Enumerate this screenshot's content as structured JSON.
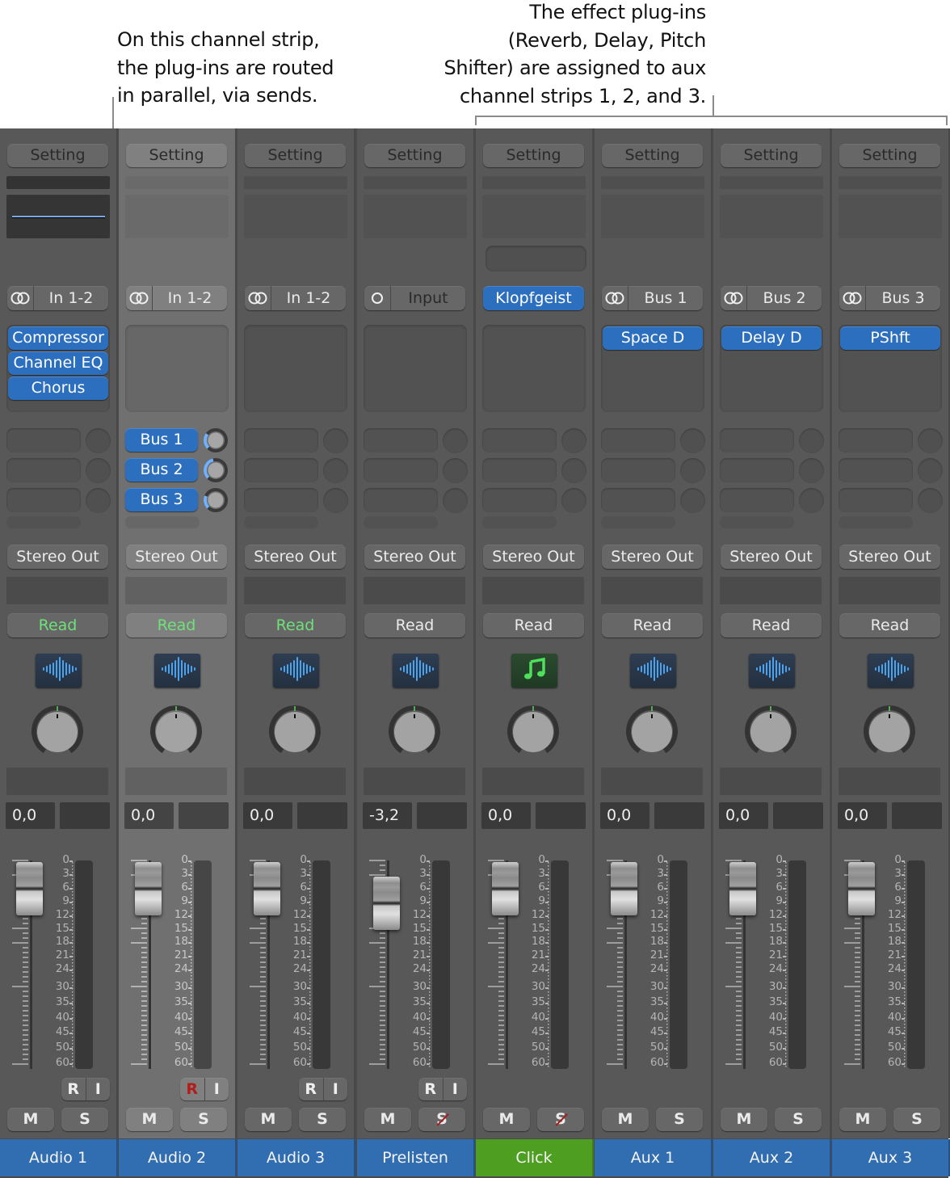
{
  "annotations": {
    "left": "On this channel strip,\nthe plug-ins are routed\nin parallel, via sends.",
    "right": "The effect plug-ins\n(Reverb, Delay, Pitch\nShifter) are assigned to aux\nchannel strips 1, 2, and 3."
  },
  "mixer": {
    "setting_label": "Setting",
    "fader_scale": [
      "0",
      "3",
      "6",
      "9",
      "12",
      "15",
      "18",
      "21",
      "24",
      "30",
      "35",
      "40",
      "45",
      "50",
      "60"
    ],
    "mute_label": "M",
    "solo_label": "S",
    "record_label": "R",
    "input_monitor_label": "I",
    "strips": [
      {
        "name": "Audio 1",
        "input": "In 1-2",
        "input_icon": "stereo-link-icon",
        "inserts": [
          "Compressor",
          "Channel EQ",
          "Chorus"
        ],
        "sends": [],
        "output": "Stereo Out",
        "automation": "Read",
        "automation_active": true,
        "track_icon": "waveform-icon",
        "volume": "0,0",
        "fader_db": 0.0,
        "record_enabled": false,
        "solo_available": true,
        "has_ri": true,
        "name_color": "#316db1",
        "selected": false
      },
      {
        "name": "Audio 2",
        "input": "In 1-2",
        "input_icon": "stereo-link-icon",
        "inserts": [],
        "sends": [
          {
            "bus": "Bus 1",
            "level": 0.3
          },
          {
            "bus": "Bus 2",
            "level": 0.45
          },
          {
            "bus": "Bus 3",
            "level": 0.25
          }
        ],
        "output": "Stereo Out",
        "automation": "Read",
        "automation_active": true,
        "track_icon": "waveform-icon",
        "volume": "0,0",
        "fader_db": 0.0,
        "record_enabled": true,
        "solo_available": true,
        "has_ri": true,
        "name_color": "#316db1",
        "selected": true
      },
      {
        "name": "Audio 3",
        "input": "In 1-2",
        "input_icon": "stereo-link-icon",
        "inserts": [],
        "sends": [],
        "output": "Stereo Out",
        "automation": "Read",
        "automation_active": true,
        "track_icon": "waveform-icon",
        "volume": "0,0",
        "fader_db": 0.0,
        "record_enabled": false,
        "solo_available": true,
        "has_ri": true,
        "name_color": "#316db1",
        "selected": false
      },
      {
        "name": "Prelisten",
        "input": "Input",
        "input_icon": "mono-icon",
        "inserts": [],
        "sends": [],
        "output": "Stereo Out",
        "automation": "Read",
        "automation_active": false,
        "track_icon": "waveform-icon",
        "volume": "-3,2",
        "fader_db": -3.2,
        "record_enabled": false,
        "solo_available": false,
        "has_ri": true,
        "name_color": "#316db1",
        "selected": false
      },
      {
        "name": "Click",
        "input": "Klopfgeist",
        "input_icon": "",
        "inserts": [],
        "sends": [],
        "output": "Stereo Out",
        "automation": "Read",
        "automation_active": false,
        "track_icon": "music-note-icon",
        "volume": "0,0",
        "fader_db": 0.0,
        "record_enabled": false,
        "solo_available": false,
        "has_ri": false,
        "name_color": "#4e9e22",
        "selected": false
      },
      {
        "name": "Aux 1",
        "input": "Bus 1",
        "input_icon": "stereo-link-icon",
        "inserts": [
          "Space D"
        ],
        "sends": [],
        "output": "Stereo Out",
        "automation": "Read",
        "automation_active": false,
        "track_icon": "waveform-icon",
        "volume": "0,0",
        "fader_db": 0.0,
        "record_enabled": false,
        "solo_available": true,
        "has_ri": false,
        "name_color": "#316db1",
        "selected": false
      },
      {
        "name": "Aux 2",
        "input": "Bus 2",
        "input_icon": "stereo-link-icon",
        "inserts": [
          "Delay D"
        ],
        "sends": [],
        "output": "Stereo Out",
        "automation": "Read",
        "automation_active": false,
        "track_icon": "waveform-icon",
        "volume": "0,0",
        "fader_db": 0.0,
        "record_enabled": false,
        "solo_available": true,
        "has_ri": false,
        "name_color": "#316db1",
        "selected": false
      },
      {
        "name": "Aux 3",
        "input": "Bus 3",
        "input_icon": "stereo-link-icon",
        "inserts": [
          "PShft"
        ],
        "sends": [],
        "output": "Stereo Out",
        "automation": "Read",
        "automation_active": false,
        "track_icon": "waveform-icon",
        "volume": "0,0",
        "fader_db": 0.0,
        "record_enabled": false,
        "solo_available": true,
        "has_ri": false,
        "name_color": "#316db1",
        "selected": false
      }
    ]
  }
}
